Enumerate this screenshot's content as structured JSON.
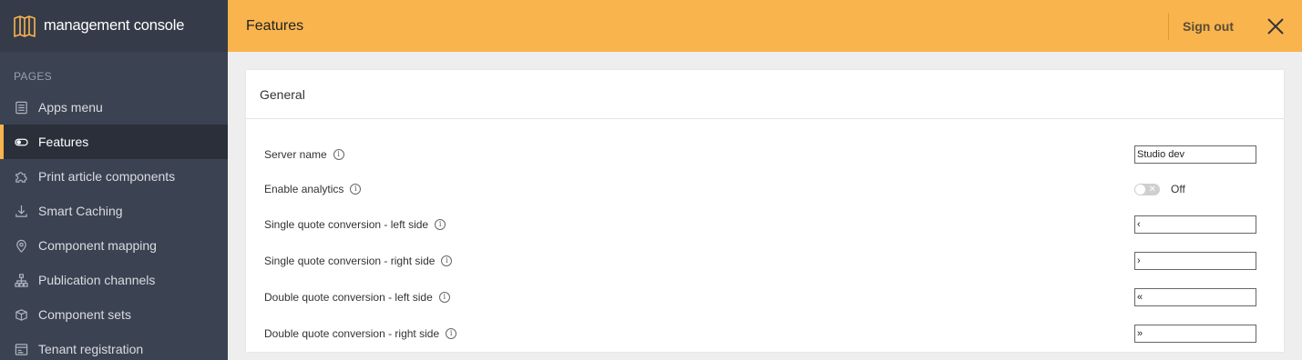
{
  "app": {
    "brand": "management console"
  },
  "sidebar": {
    "section_label": "PAGES",
    "items": [
      {
        "label": "Apps menu",
        "icon": "list-icon"
      },
      {
        "label": "Features",
        "icon": "toggle-icon",
        "active": true
      },
      {
        "label": "Print article components",
        "icon": "puzzle-icon"
      },
      {
        "label": "Smart Caching",
        "icon": "download-icon"
      },
      {
        "label": "Component mapping",
        "icon": "map-pin-icon"
      },
      {
        "label": "Publication channels",
        "icon": "sitemap-icon"
      },
      {
        "label": "Component sets",
        "icon": "box-icon"
      },
      {
        "label": "Tenant registration",
        "icon": "registration-icon"
      }
    ]
  },
  "header": {
    "title": "Features",
    "signout_label": "Sign out",
    "accent": "#f9b44d"
  },
  "card": {
    "title": "General",
    "rows": [
      {
        "label": "Server name",
        "type": "text",
        "value": "Studio dev"
      },
      {
        "label": "Enable analytics",
        "type": "toggle",
        "value": "Off"
      },
      {
        "label": "Single quote conversion - left side",
        "type": "text",
        "value": "‹"
      },
      {
        "label": "Single quote conversion - right side",
        "type": "text",
        "value": "›"
      },
      {
        "label": "Double quote conversion - left side",
        "type": "text",
        "value": "«"
      },
      {
        "label": "Double quote conversion - right side",
        "type": "text",
        "value": "»"
      }
    ]
  }
}
